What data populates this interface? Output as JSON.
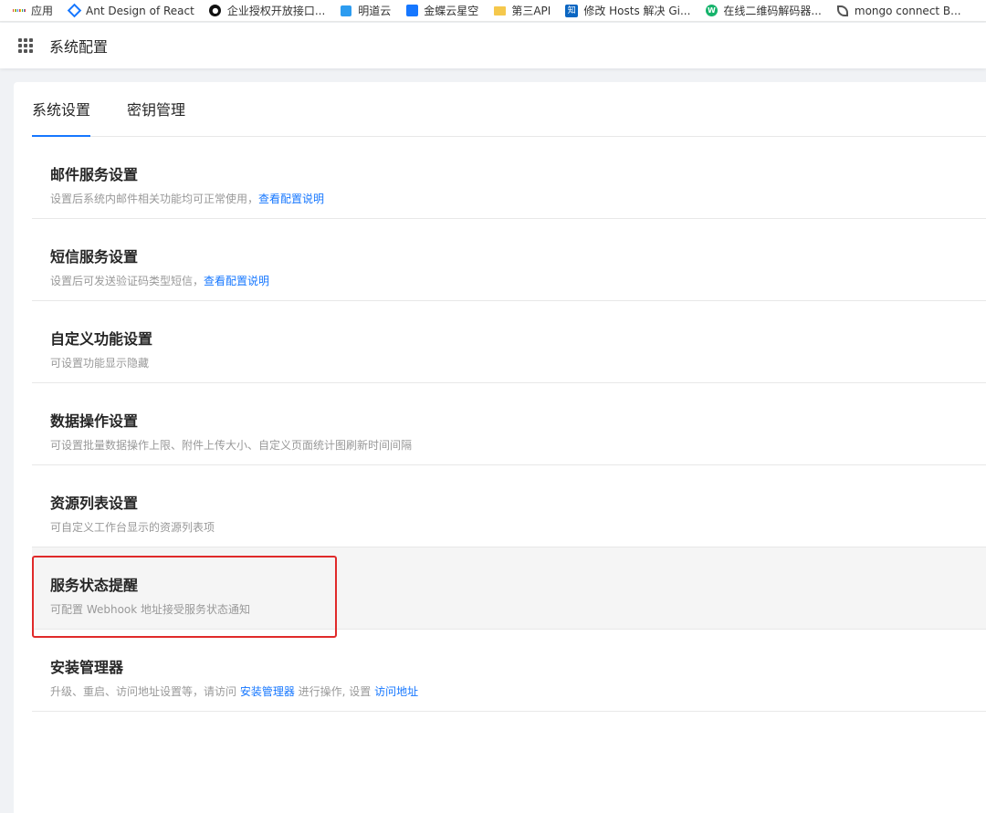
{
  "bookmarks": [
    {
      "label": "应用",
      "icon": "apps-grid-icon"
    },
    {
      "label": "Ant Design of React",
      "icon": "antd-logo-icon"
    },
    {
      "label": "企业授权开放接口...",
      "icon": "circle-logo-icon"
    },
    {
      "label": "明道云",
      "icon": "cube-logo-icon"
    },
    {
      "label": "金蝶云星空",
      "icon": "square-logo-icon"
    },
    {
      "label": "第三API",
      "icon": "folder-icon"
    },
    {
      "label": "修改 Hosts 解决 Gi...",
      "icon": "zhihu-logo-icon"
    },
    {
      "label": "在线二维码解码器...",
      "icon": "w-logo-icon"
    },
    {
      "label": "mongo connect B...",
      "icon": "leaf-logo-icon"
    }
  ],
  "header": {
    "title": "系统配置"
  },
  "tabs": [
    {
      "label": "系统设置",
      "active": true
    },
    {
      "label": "密钥管理",
      "active": false
    }
  ],
  "settings": [
    {
      "title": "邮件服务设置",
      "desc": "设置后系统内邮件相关功能均可正常使用，",
      "link": "查看配置说明"
    },
    {
      "title": "短信服务设置",
      "desc": "设置后可发送验证码类型短信，",
      "link": "查看配置说明"
    },
    {
      "title": "自定义功能设置",
      "desc": "可设置功能显示隐藏"
    },
    {
      "title": "数据操作设置",
      "desc": "可设置批量数据操作上限、附件上传大小、自定义页面统计图刷新时间间隔"
    },
    {
      "title": "资源列表设置",
      "desc": "可自定义工作台显示的资源列表项"
    },
    {
      "title": "服务状态提醒",
      "desc": "可配置 Webhook 地址接受服务状态通知"
    },
    {
      "title": "安装管理器",
      "desc_a": "升级、重启、访问地址设置等，请访问 ",
      "link_a": "安装管理器",
      "desc_b": " 进行操作, 设置 ",
      "link_b": "访问地址"
    }
  ],
  "colors": {
    "accent": "#1677ff",
    "highlight_border": "#e02a2a"
  }
}
